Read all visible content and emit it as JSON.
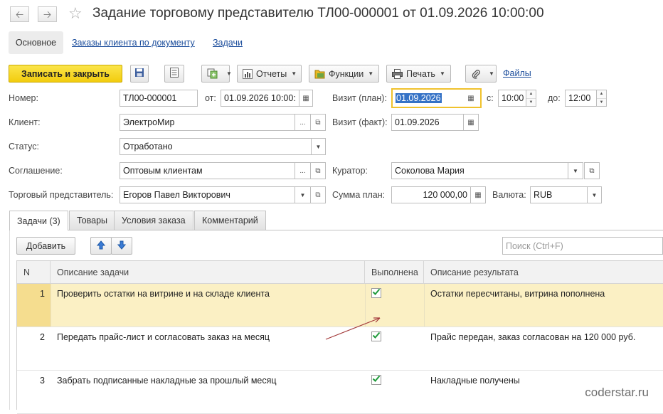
{
  "header": {
    "back_icon": "arrow-left-icon",
    "forward_icon": "arrow-right-icon",
    "favorite_icon": "star-icon",
    "title": "Задание торговому представителю ТЛ00-000001 от 01.09.2026 10:00:00"
  },
  "sections": {
    "main": "Основное",
    "orders": "Заказы клиента по документу",
    "tasks": "Задачи"
  },
  "toolbar": {
    "save_close": "Записать и закрыть",
    "reports": "Отчеты",
    "functions": "Функции",
    "print": "Печать",
    "files": "Файлы"
  },
  "form": {
    "number_label": "Номер:",
    "number_value": "ТЛ00-000001",
    "from_label": "от:",
    "from_value": "01.09.2026 10:00:",
    "visit_plan_label": "Визит (план):",
    "visit_plan_value": "01.09.2026",
    "time_from_label": "с:",
    "time_from_value": "10:00",
    "time_to_label": "до:",
    "time_to_value": "12:00",
    "client_label": "Клиент:",
    "client_value": "ЭлектроМир",
    "visit_fact_label": "Визит (факт):",
    "visit_fact_value": "01.09.2026",
    "status_label": "Статус:",
    "status_value": "Отработано",
    "agreement_label": "Соглашение:",
    "agreement_value": "Оптовым клиентам",
    "curator_label": "Куратор:",
    "curator_value": "Соколова Мария",
    "rep_label": "Торговый представитель:",
    "rep_value": "Егоров Павел Викторович",
    "sum_label": "Сумма план:",
    "sum_value": "120 000,00",
    "currency_label": "Валюта:",
    "currency_value": "RUB"
  },
  "tabs": {
    "tasks": "Задачи (3)",
    "goods": "Товары",
    "terms": "Условия заказа",
    "comment": "Комментарий"
  },
  "list_toolbar": {
    "add": "Добавить",
    "search_placeholder": "Поиск (Ctrl+F)"
  },
  "table": {
    "columns": [
      "N",
      "Описание задачи",
      "Выполнена",
      "Описание результата"
    ],
    "rows": [
      {
        "n": "1",
        "desc": "Проверить остатки на витрине и на складе клиента",
        "done": true,
        "result": "Остатки пересчитаны, витрина пополнена"
      },
      {
        "n": "2",
        "desc": "Передать прайс-лист и согласовать заказ на месяц",
        "done": true,
        "result": "Прайс передан, заказ согласован на 120 000 руб."
      },
      {
        "n": "3",
        "desc": "Забрать подписанные накладные за прошлый месяц",
        "done": true,
        "result": "Накладные получены"
      }
    ]
  },
  "watermark": "coderstar.ru",
  "colors": {
    "primary_button": "#f5d11c",
    "link": "#1a4c9b",
    "selected_row": "#fbf0c4",
    "annotation_arrow": "#a33a3a"
  }
}
